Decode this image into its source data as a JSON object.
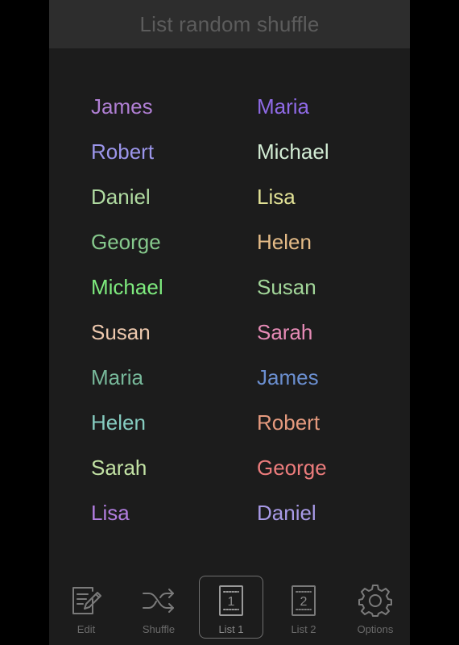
{
  "header": {
    "title": "List random shuffle"
  },
  "lists": {
    "left": [
      {
        "name": "James",
        "color": "#b07fd4"
      },
      {
        "name": "Robert",
        "color": "#9b95ea"
      },
      {
        "name": "Daniel",
        "color": "#b0dba1"
      },
      {
        "name": "George",
        "color": "#86c98c"
      },
      {
        "name": "Michael",
        "color": "#7eeb7e"
      },
      {
        "name": "Susan",
        "color": "#edc8ad"
      },
      {
        "name": "Maria",
        "color": "#77b89a"
      },
      {
        "name": "Helen",
        "color": "#85cbbf"
      },
      {
        "name": "Sarah",
        "color": "#c2e2a4"
      },
      {
        "name": "Lisa",
        "color": "#b27ee0"
      }
    ],
    "right": [
      {
        "name": "Maria",
        "color": "#8f6ae6"
      },
      {
        "name": "Michael",
        "color": "#d2ecd4"
      },
      {
        "name": "Lisa",
        "color": "#e2e296"
      },
      {
        "name": "Helen",
        "color": "#e4bb87"
      },
      {
        "name": "Susan",
        "color": "#a3d79a"
      },
      {
        "name": "Sarah",
        "color": "#e68bb6"
      },
      {
        "name": "James",
        "color": "#6b8fd0"
      },
      {
        "name": "Robert",
        "color": "#e59a7e"
      },
      {
        "name": "George",
        "color": "#ec7c7c"
      },
      {
        "name": "Daniel",
        "color": "#a89ae6"
      }
    ]
  },
  "tabs": [
    {
      "label": "Edit",
      "icon": "edit-icon",
      "active": false
    },
    {
      "label": "Shuffle",
      "icon": "shuffle-icon",
      "active": false
    },
    {
      "label": "List 1",
      "icon": "list-1-icon",
      "active": true
    },
    {
      "label": "List 2",
      "icon": "list-2-icon",
      "active": false
    },
    {
      "label": "Options",
      "icon": "gear-icon",
      "active": false
    }
  ],
  "list_icon_numbers": {
    "list1": "1",
    "list2": "2"
  }
}
